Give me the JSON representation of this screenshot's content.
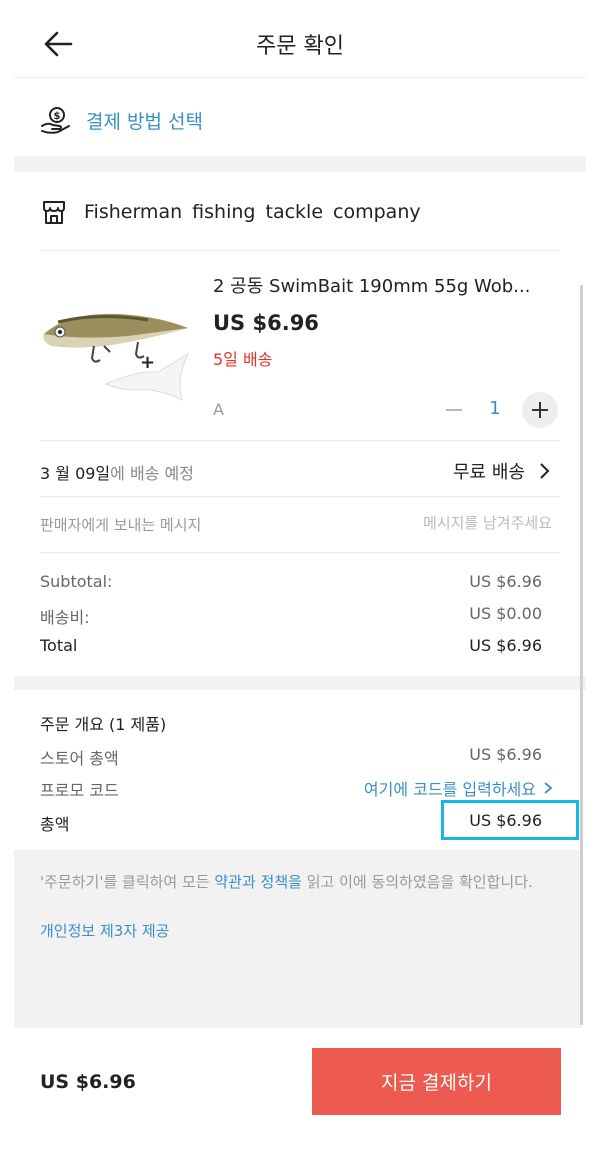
{
  "header": {
    "title": "주문 확인"
  },
  "payment": {
    "label": "결제 방법 선택"
  },
  "store": {
    "name": "Fisherman  fishing  tackle company"
  },
  "product": {
    "title": "2 공동 SwimBait 190mm 55g Wob...",
    "price": "US $6.96",
    "delivery": "5일 배송",
    "variant": "A",
    "quantity": "1"
  },
  "shipping": {
    "date_strong": "3 월 09일",
    "date_muted": "에 배송 예정",
    "method": "무료 배송"
  },
  "message": {
    "label": "판매자에게 보내는 메시지",
    "placeholder": "메시지를 남겨주세요"
  },
  "totals": {
    "subtotal_label": "Subtotal:",
    "subtotal_value": "US $6.96",
    "shipping_label": "배송비:",
    "shipping_value": "US $0.00",
    "total_label": "Total",
    "total_value": "US $6.96"
  },
  "overview": {
    "title": "주문 개요 (1 제품)",
    "store_total_label": "스토어 총액",
    "store_total_value": "US $6.96",
    "promo_label": "프로모 코드",
    "promo_link": "여기에 코드를 입력하세요",
    "grand_label": "총액",
    "grand_value": "US $6.96"
  },
  "terms": {
    "part1": "'주문하기'를 클릭하여 모든 ",
    "link": "약관과 정책을",
    "part2": " 읽고 이에 동의하였음을 확인합니다.",
    "privacy": "개인정보 제3자 제공"
  },
  "footer": {
    "total": "US $6.96",
    "pay_button": "지금 결제하기"
  },
  "colors": {
    "accent_blue": "#3a8fc7",
    "delivery_red": "#e1332b",
    "pay_button": "#ec5a50",
    "highlight": "#19b5e8"
  }
}
